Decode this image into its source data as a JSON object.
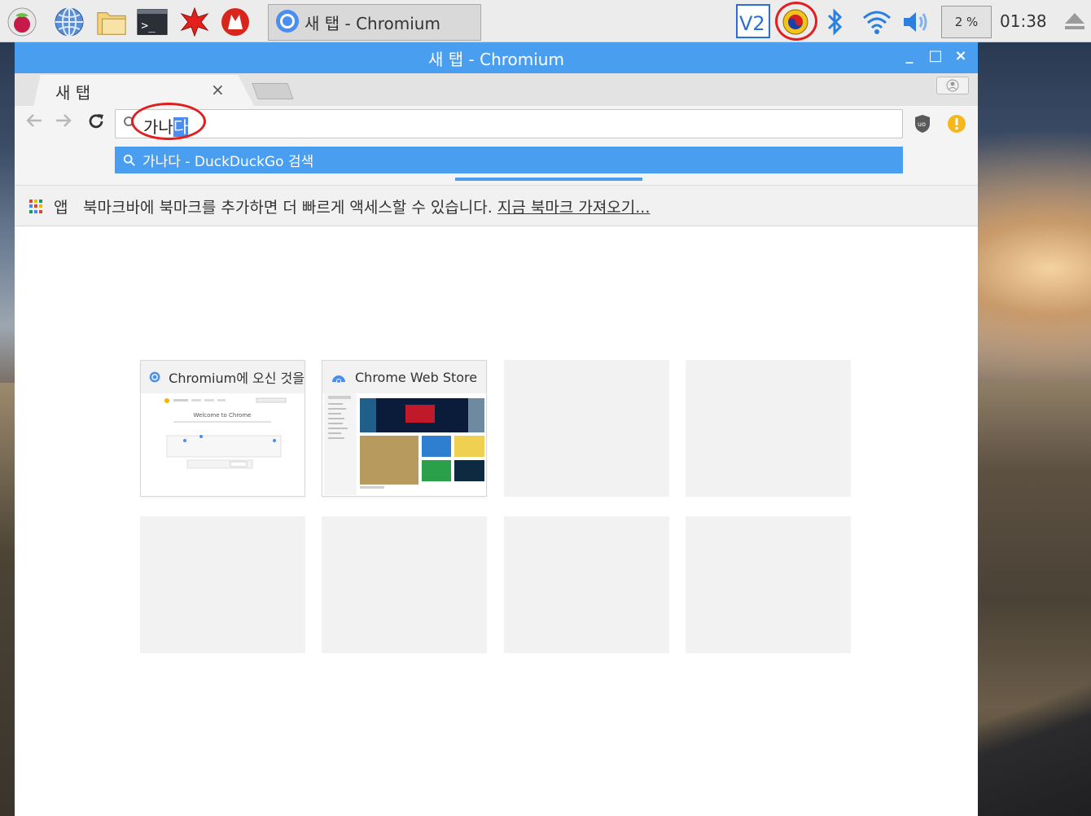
{
  "taskbar": {
    "task_title": "새 탭 - Chromium",
    "cpu_usage": "2 %",
    "clock": "01:38",
    "launcher_icons": [
      "raspberry-menu-icon",
      "web-browser-icon",
      "file-manager-icon",
      "terminal-icon",
      "mathematica-icon",
      "wolfram-icon"
    ],
    "tray_icons": [
      "vnc-icon",
      "ime-icon",
      "bluetooth-icon",
      "wifi-icon",
      "volume-icon",
      "eject-icon"
    ]
  },
  "window": {
    "title": "새 탭 - Chromium",
    "controls": {
      "minimize": "_",
      "maximize": "□",
      "close": "×"
    }
  },
  "tabs": [
    {
      "title": "새 탭",
      "close": "×"
    }
  ],
  "omnibox": {
    "typed": "가나",
    "selected": "다"
  },
  "suggestion": {
    "text": "가나다 - DuckDuckGo 검색"
  },
  "bookmark_bar": {
    "apps_label": "앱",
    "message": "북마크바에 북마크를 추가하면 더 빠르게 액세스할 수 있습니다.",
    "import_link": "지금 북마크 가져오기..."
  },
  "most_visited": [
    {
      "title": "Chromium에 오신 것을",
      "thumb_text": "Welcome to Chrome"
    },
    {
      "title": "Chrome Web Store"
    }
  ],
  "colors": {
    "accent": "#4a9ef0",
    "selection": "#4a8ef5",
    "annotation_red": "#e02020"
  }
}
